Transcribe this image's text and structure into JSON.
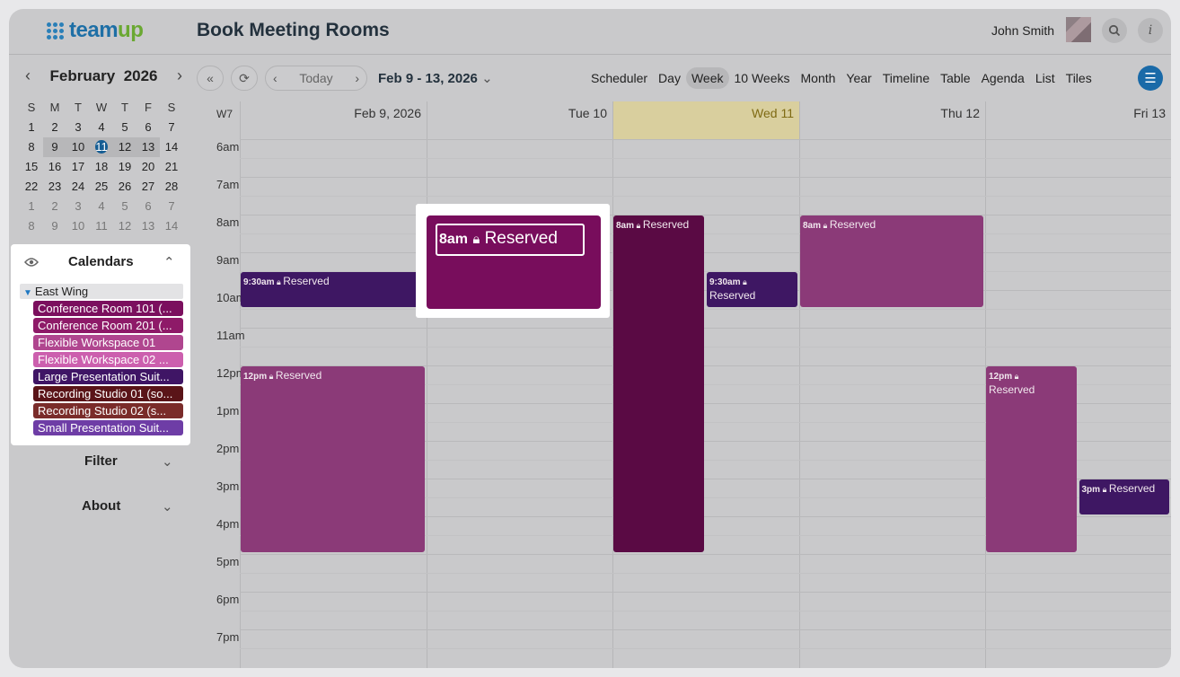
{
  "brand": {
    "name_part1": "team",
    "name_part2": "up"
  },
  "header": {
    "title": "Book Meeting Rooms",
    "user": "John Smith",
    "search_icon": "search-icon",
    "info_icon": "info-icon"
  },
  "mini_calendar": {
    "month": "February",
    "year": "2026",
    "weekdays": [
      "S",
      "M",
      "T",
      "W",
      "T",
      "F",
      "S"
    ],
    "weeks": [
      [
        "1",
        "2",
        "3",
        "4",
        "5",
        "6",
        "7"
      ],
      [
        "8",
        "9",
        "10",
        "11",
        "12",
        "13",
        "14"
      ],
      [
        "15",
        "16",
        "17",
        "18",
        "19",
        "20",
        "21"
      ],
      [
        "22",
        "23",
        "24",
        "25",
        "26",
        "27",
        "28"
      ],
      [
        "1",
        "2",
        "3",
        "4",
        "5",
        "6",
        "7"
      ],
      [
        "8",
        "9",
        "10",
        "11",
        "12",
        "13",
        "14"
      ]
    ],
    "today": "11"
  },
  "calendars_panel": {
    "title": "Calendars",
    "group": "East Wing",
    "items": [
      {
        "label": "Conference Room 101 (...",
        "color": "#7b0f5e"
      },
      {
        "label": "Conference Room 201 (...",
        "color": "#8e1a68"
      },
      {
        "label": "Flexible Workspace 01",
        "color": "#b0468f"
      },
      {
        "label": "Flexible Workspace 02 ...",
        "color": "#cc5fae"
      },
      {
        "label": "Large Presentation Suit...",
        "color": "#3f1565"
      },
      {
        "label": "Recording Studio 01 (so...",
        "color": "#5a1418"
      },
      {
        "label": "Recording Studio 02 (s...",
        "color": "#7a2c2a"
      },
      {
        "label": "Small Presentation Suit...",
        "color": "#6e3da6"
      }
    ]
  },
  "sidebar_sections": {
    "filter": "Filter",
    "about": "About"
  },
  "toolbar": {
    "today": "Today",
    "range": "Feb 9 - 13, 2026",
    "views": [
      "Scheduler",
      "Day",
      "Week",
      "10 Weeks",
      "Month",
      "Year",
      "Timeline",
      "Table",
      "Agenda",
      "List",
      "Tiles"
    ],
    "active_view": "Week"
  },
  "week": {
    "week_number": "W7",
    "days": [
      "Feb 9, 2026",
      "Tue 10",
      "Wed 11",
      "Thu 12",
      "Fri 13"
    ],
    "today_index": 2,
    "hours": [
      "6am",
      "7am",
      "8am",
      "9am",
      "10am",
      "11am",
      "12pm",
      "1pm",
      "2pm",
      "3pm",
      "4pm",
      "5pm",
      "6pm",
      "7pm"
    ]
  },
  "events": [
    {
      "day": 0,
      "start": 9.5,
      "end": 10.5,
      "time": "9:30am",
      "title": "Reserved",
      "color": "#3e1763",
      "col_start": 0,
      "col_end": 1
    },
    {
      "day": 0,
      "start": 12,
      "end": 17,
      "time": "12pm",
      "title": "Reserved",
      "color": "#8b3a78",
      "col_start": 0,
      "col_end": 1
    },
    {
      "day": 2,
      "start": 8,
      "end": 17,
      "time": "8am",
      "title": "Reserved",
      "color": "#5a0a44",
      "col_start": 0,
      "col_end": 0.5
    },
    {
      "day": 2,
      "start": 9.5,
      "end": 10.5,
      "time": "9:30am",
      "title": "Reserved",
      "color": "#3e1763",
      "col_start": 0.5,
      "col_end": 1,
      "wrap": true
    },
    {
      "day": 3,
      "start": 8,
      "end": 10.5,
      "time": "8am",
      "title": "Reserved",
      "color": "#8b3a78",
      "col_start": 0,
      "col_end": 1
    },
    {
      "day": 4,
      "start": 12,
      "end": 17,
      "time": "12pm",
      "title": "Reserved",
      "color": "#8b3a78",
      "col_start": 0,
      "col_end": 0.5,
      "wrap": true
    },
    {
      "day": 4,
      "start": 15,
      "end": 16,
      "time": "3pm",
      "title": "Reserved",
      "color": "#3e1763",
      "col_start": 0.5,
      "col_end": 1
    }
  ],
  "popover": {
    "time": "8am",
    "title": "Reserved",
    "color": "#780d5c"
  }
}
